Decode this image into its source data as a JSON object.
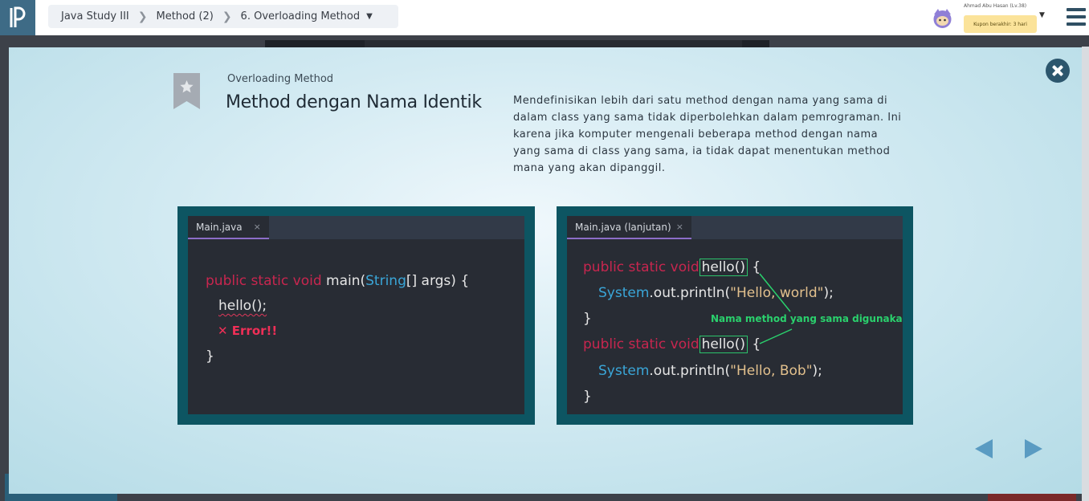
{
  "breadcrumb": {
    "course": "Java Study III",
    "section": "Method (2)",
    "lesson": "6. Overloading Method"
  },
  "user": {
    "name": "Ahmad Abu Hasan (Lv.38)",
    "coupon": "Kupon berakhir: 3 hari"
  },
  "slide": {
    "subtitle": "Overloading Method",
    "title": "Method dengan Nama Identik",
    "description": "Mendefinisikan lebih dari satu method dengan nama yang sama di dalam class yang sama tidak diperbolehkan dalam pemrograman. Ini karena jika komputer mengenali beberapa method dengan nama yang sama di class yang sama, ia tidak dapat menentukan method mana yang akan dipanggil."
  },
  "left_editor": {
    "tab": "Main.java",
    "tab_close": "×",
    "line1": {
      "kw": "public static void",
      "name": " main(",
      "type": "String",
      "rest": "[] args) {"
    },
    "line2": "hello();",
    "error": "✕ Error!!",
    "line4": "}"
  },
  "right_editor": {
    "tab": "Main.java (lanjutan)",
    "tab_close": "×",
    "line1": {
      "kw": "public static void",
      "name": "hello()",
      "rest": " {"
    },
    "line2": {
      "type": "System",
      "mid": ".out.println(",
      "str": "\"Hello, world\"",
      "rest": ");"
    },
    "line3": "}",
    "line4": {
      "kw": "public static void",
      "name": "hello()",
      "rest": " {"
    },
    "line5": {
      "type": "System",
      "mid": ".out.println(",
      "str": "\"Hello, Bob\"",
      "rest": ");"
    },
    "line6": "}",
    "callout": "Nama method yang sama digunakan"
  },
  "colors": {
    "keyword": "#c8264f",
    "type": "#3aa6d8",
    "string": "#e2c08d",
    "callout": "#2ad16d",
    "panel_border": "#0d5562",
    "nav_arrow": "#5a9bc2"
  },
  "icons": {
    "logo": "progate-logo-icon",
    "close": "close-circle-icon",
    "bookmark": "bookmark-star-icon",
    "menu": "hamburger-menu-icon",
    "prev": "triangle-left-icon",
    "next": "triangle-right-icon"
  }
}
